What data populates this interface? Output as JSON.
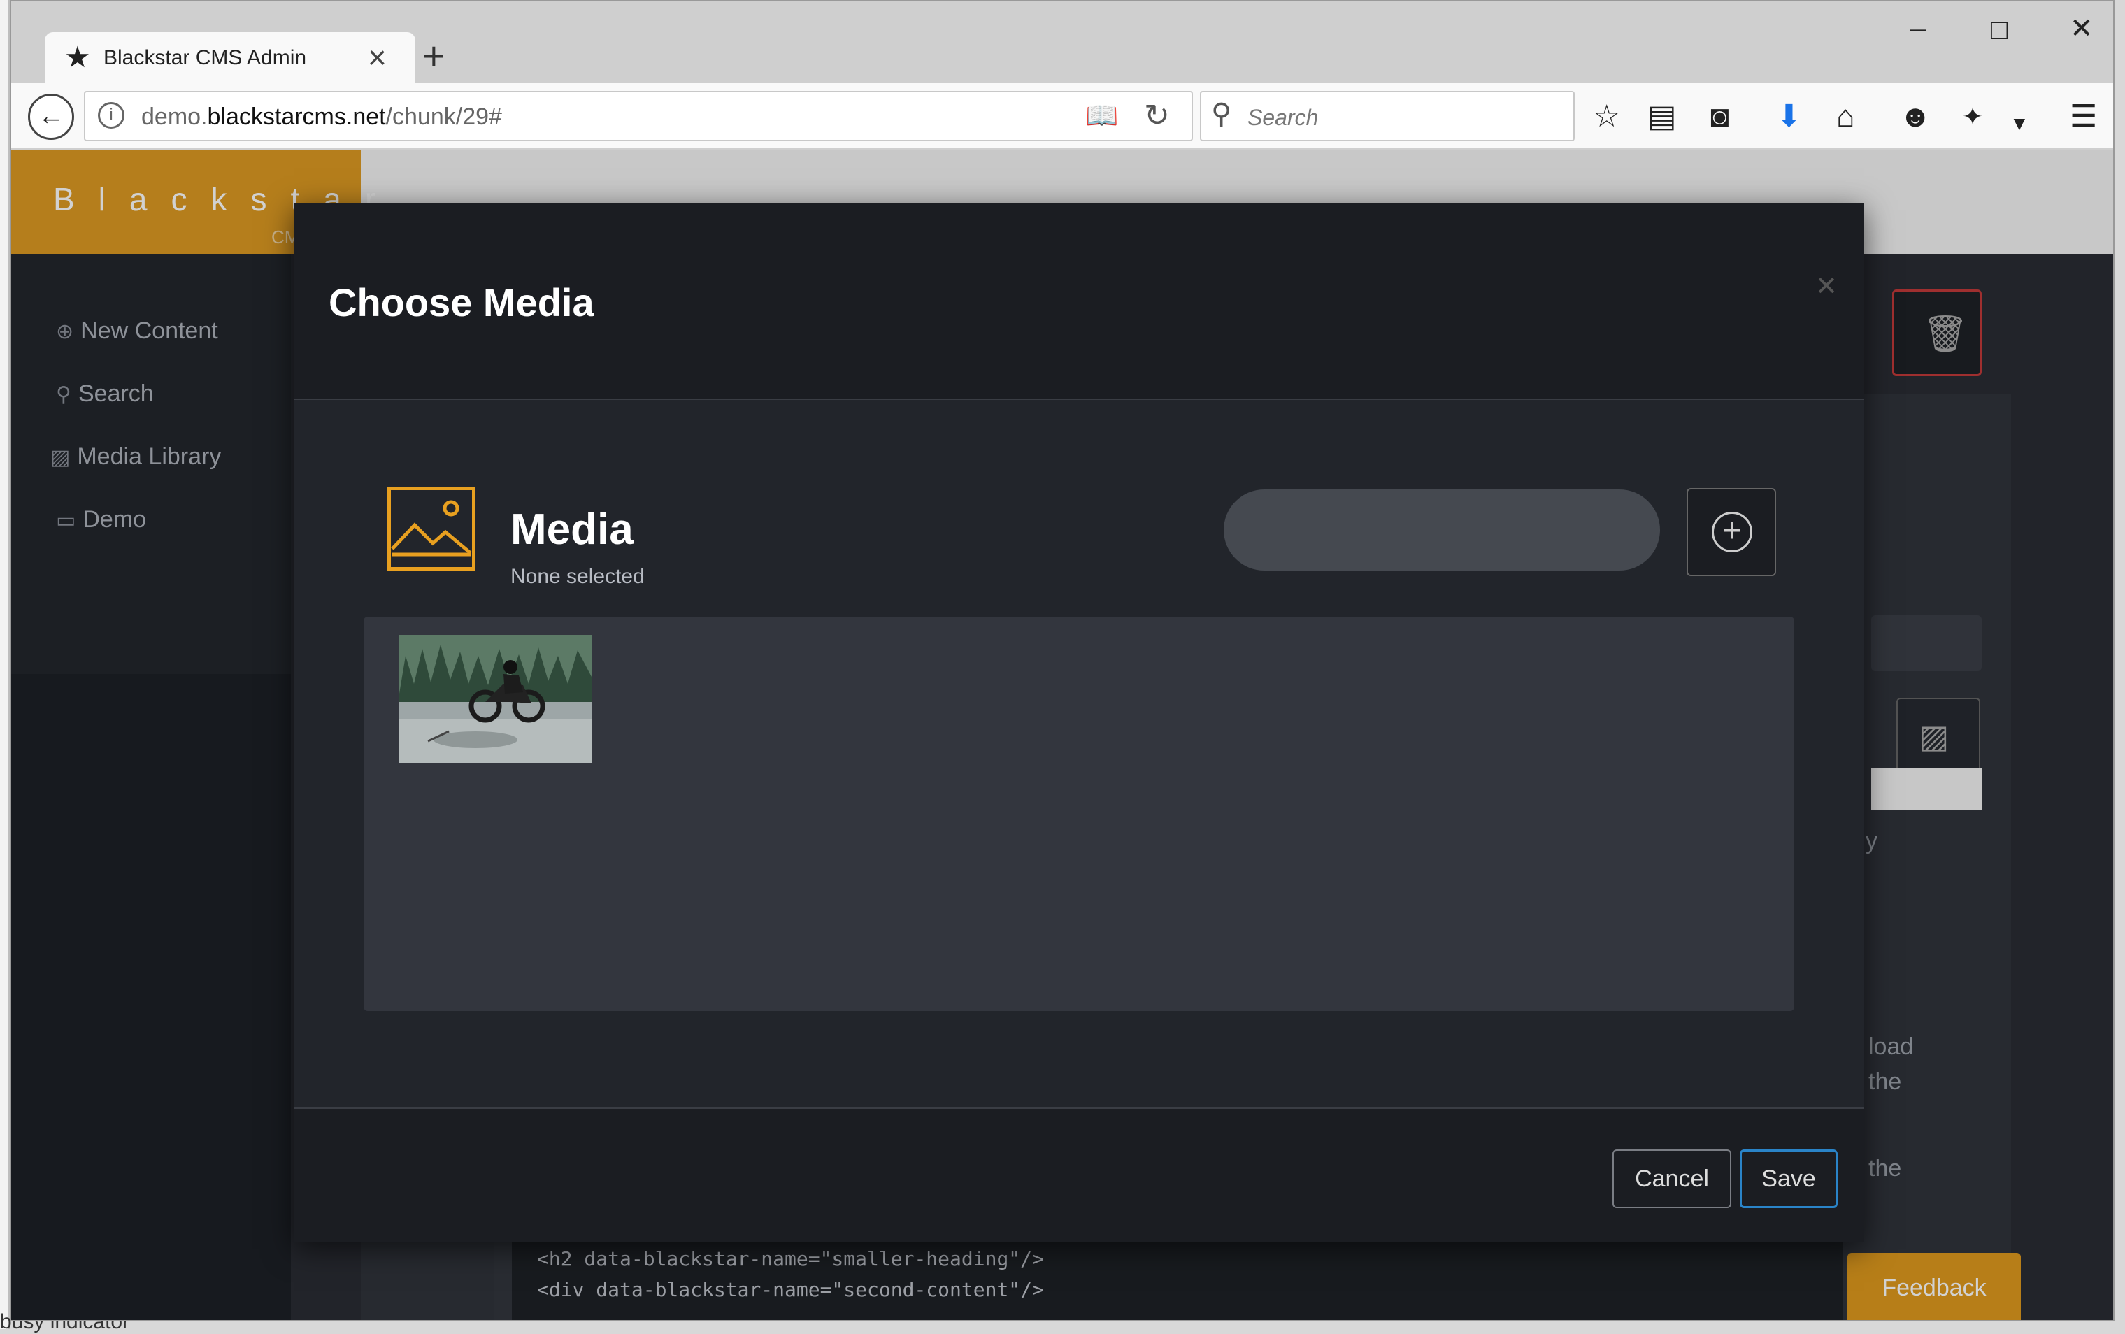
{
  "browser": {
    "tab_title": "Blackstar CMS Admin",
    "url_prefix": "demo.",
    "url_domain": "blackstarcms.net",
    "url_path": "/chunk/29#",
    "search_placeholder": "Search"
  },
  "app": {
    "logo_text": "Blackstar",
    "logo_sub": "CMS",
    "sidebar": [
      {
        "label": "New Content",
        "icon": "plus-circle-icon"
      },
      {
        "label": "Search",
        "icon": "search-icon"
      },
      {
        "label": "Media Library",
        "icon": "image-icon"
      },
      {
        "label": "Demo",
        "icon": "monitor-icon"
      }
    ],
    "background_fragments": [
      "y",
      "load",
      "the",
      "the"
    ],
    "code_lines": [
      "<h2 data-blackstar-name=\"smaller-heading\"/>",
      "<div data-blackstar-name=\"second-content\"/>"
    ],
    "feedback_label": "Feedback",
    "left_strip_text": "busy indicator"
  },
  "modal": {
    "title": "Choose Media",
    "media_title": "Media",
    "media_status": "None selected",
    "search_value": "",
    "cancel_label": "Cancel",
    "save_label": "Save"
  },
  "colors": {
    "accent": "#e8a020",
    "primary_border": "#2a84c8",
    "danger_border": "#c23a3a",
    "modal_bg": "#1b1d22"
  }
}
